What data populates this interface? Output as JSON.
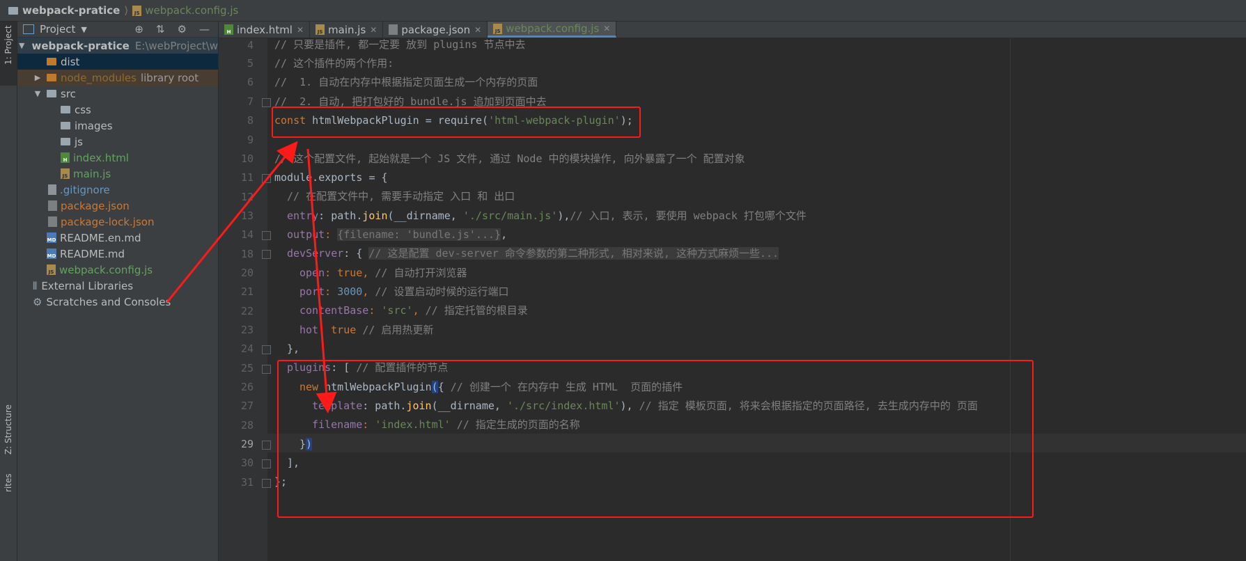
{
  "breadcrumb": {
    "project": "webpack-pratice",
    "file": "webpack.config.js"
  },
  "left_strip": {
    "project_tab": "1: Project",
    "structure_tab": "Z: Structure",
    "favorites_tab": "rites"
  },
  "project_panel": {
    "title": "Project",
    "root": {
      "name": "webpack-pratice",
      "path": "E:\\webProject\\webp"
    },
    "items": [
      {
        "label": "dist"
      },
      {
        "label": "node_modules",
        "suffix": "library root"
      },
      {
        "label": "src"
      },
      {
        "label": "css"
      },
      {
        "label": "images"
      },
      {
        "label": "js"
      },
      {
        "label": "index.html"
      },
      {
        "label": "main.js"
      },
      {
        "label": ".gitignore"
      },
      {
        "label": "package.json"
      },
      {
        "label": "package-lock.json"
      },
      {
        "label": "README.en.md"
      },
      {
        "label": "README.md"
      },
      {
        "label": "webpack.config.js"
      },
      {
        "label": "External Libraries"
      },
      {
        "label": "Scratches and Consoles"
      }
    ]
  },
  "tabs": [
    {
      "label": "index.html"
    },
    {
      "label": "main.js"
    },
    {
      "label": "package.json"
    },
    {
      "label": "webpack.config.js"
    }
  ],
  "editor": {
    "line_numbers": [
      "4",
      "5",
      "6",
      "7",
      "8",
      "9",
      "10",
      "11",
      "12",
      "13",
      "14",
      "18",
      "20",
      "21",
      "22",
      "23",
      "24",
      "25",
      "26",
      "27",
      "28",
      "29",
      "30",
      "31"
    ],
    "lines": {
      "l4": "// 只要是插件, 都一定要 放到 plugins 节点中去",
      "l5": "// 这个插件的两个作用:",
      "l6": "//  1. 自动在内存中根据指定页面生成一个内存的页面",
      "l7": "//  2. 自动, 把打包好的 bundle.js 追加到页面中去",
      "l8_kw": "const",
      "l8_a": " htmlWebpackPlugin = require(",
      "l8_str": "'html-webpack-plugin'",
      "l8_b": ");",
      "l10": "// 这个配置文件, 起始就是一个 JS 文件, 通过 Node 中的模块操作, 向外暴露了一个 配置对象",
      "l11": "module.exports = {",
      "l12": "// 在配置文件中, 需要手动指定 入口 和 出口",
      "l13_prop": "entry",
      "l13_a": ": path.",
      "l13_fn": "join",
      "l13_b": "(__dirname, ",
      "l13_str": "'./src/main.js'",
      "l13_c": "),",
      "l13_cm": "// 入口, 表示, 要使用 webpack 打包哪个文件",
      "l14_prop": "output",
      "l14_inlay": "{filename: 'bundle.js'...}",
      "l14_b": ",",
      "l18_prop": "devServer",
      "l18_a": ": { ",
      "l18_cm": "// 这是配置 dev-server 命令参数的第二种形式, 相对来说, 这种方式麻烦一些...",
      "l20_prop": "open",
      "l20_kw": "true",
      "l20_cm": "// 自动打开浏览器",
      "l21_prop": "port",
      "l21_num": "3000",
      "l21_cm": "// 设置启动时候的运行端口",
      "l22_prop": "contentBase",
      "l22_str": "'src'",
      "l22_cm": "// 指定托管的根目录",
      "l23_prop": "hot",
      "l23_kw": "true",
      "l23_cm": "// 启用热更新",
      "l24": "},",
      "l25_prop": "plugins",
      "l25_a": ": [ ",
      "l25_cm": "// 配置插件的节点",
      "l26_kw": "new",
      "l26_a": " htmlWebpackPlugin",
      "l26_paren": "(",
      "l26_b": "{ ",
      "l26_cm": "// 创建一个 在内存中 生成 HTML  页面的插件",
      "l27_prop": "template",
      "l27_a": ": path.",
      "l27_fn": "join",
      "l27_b": "(__dirname, ",
      "l27_str": "'./src/index.html'",
      "l27_c": "), ",
      "l27_cm": "// 指定 模板页面, 将来会根据指定的页面路径, 去生成内存中的 页面",
      "l28_prop": "filename",
      "l28_str": "'index.html'",
      "l28_cm": "// 指定生成的页面的名称",
      "l29_a": "}",
      "l29_paren": ")",
      "l30": "],",
      "l31": "};"
    }
  },
  "colors": {
    "annotation": "#ff1a1a",
    "keyword": "#cc7832",
    "string": "#6a8759",
    "comment": "#808080"
  }
}
